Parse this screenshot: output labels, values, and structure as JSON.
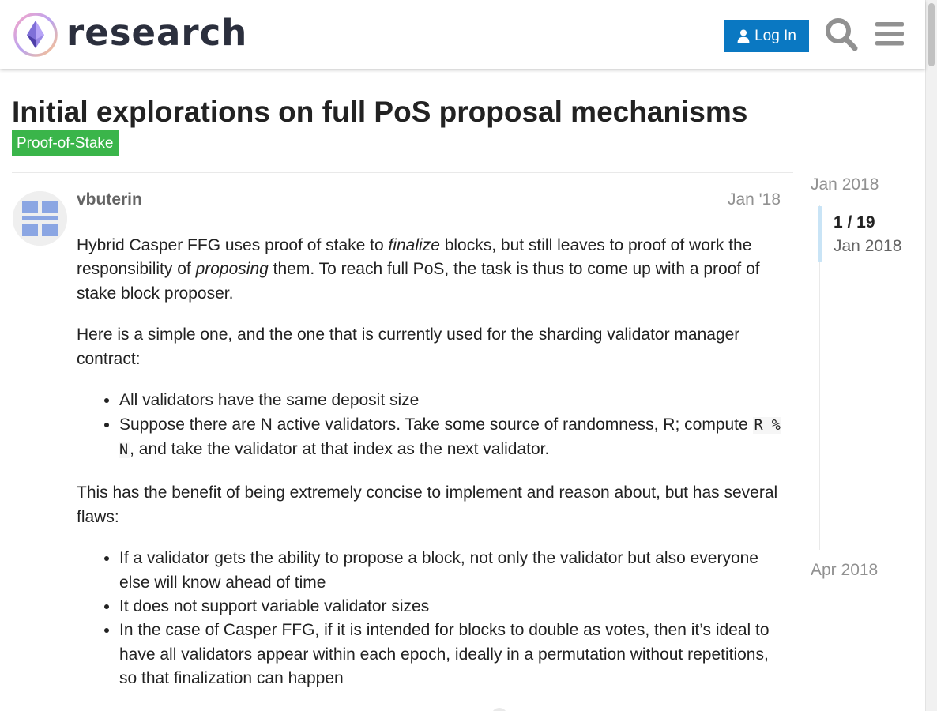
{
  "header": {
    "logo_text": "research",
    "login_label": "Log In",
    "icons": {
      "logo": "research-logo",
      "login": "person-icon",
      "search": "search-icon",
      "menu": "hamburger-menu-icon"
    },
    "colors": {
      "login_button": "#0a78c2"
    }
  },
  "topic": {
    "title": "Initial explorations on full PoS proposal mechanisms",
    "category": "Proof-of-Stake",
    "category_color": "#3ab54a"
  },
  "post": {
    "username": "vbuterin",
    "date": "Jan '18",
    "p1": {
      "t1": "Hybrid Casper FFG uses proof of stake to ",
      "em1": "finalize",
      "t2": " blocks, but still leaves to proof of work the responsibility of ",
      "em2": "proposing",
      "t3": " them. To reach full PoS, the task is thus to come up with a proof of stake block proposer."
    },
    "p2": "Here is a simple one, and the one that is currently used for the sharding validator manager contract:",
    "list1": {
      "item1": "All validators have the same deposit size",
      "item2_a": "Suppose there are N active validators. Take some source of randomness, R; compute ",
      "item2_code": "R % N",
      "item2_b": ", and take the validator at that index as the next validator."
    },
    "p3": "This has the benefit of being extremely concise to implement and reason about, but has several flaws:",
    "list2": [
      "If a validator gets the ability to propose a block, not only the validator but also everyone else will know ahead of time",
      "It does not support variable validator sizes",
      "In the case of Casper FFG, if it is intended for blocks to double as votes, then it’s ideal to have all validators appear within each epoch, ideally in a permutation without repetitions, so that finalization can happen"
    ]
  },
  "timeline": {
    "start_date": "Jan 2018",
    "counter": "1 / 19",
    "current_date": "Jan 2018",
    "end_date": "Apr 2018",
    "handle_color": "#c9e4f6"
  }
}
